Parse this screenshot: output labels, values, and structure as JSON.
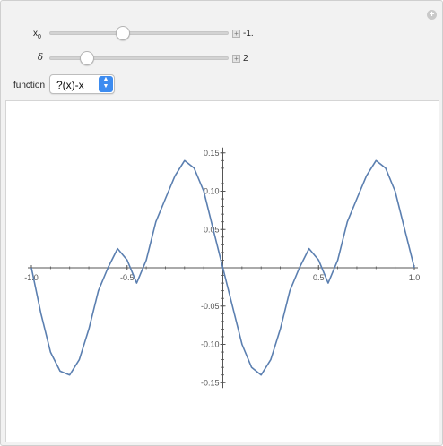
{
  "controls": {
    "x0": {
      "label": "x",
      "sub": "0",
      "value_text": "-1.",
      "value": -1.0
    },
    "delta": {
      "label": "δ",
      "value_text": "2",
      "value": 2
    },
    "function": {
      "label": "function",
      "selected": "?(x)-x"
    }
  },
  "icons": {
    "corner": "plus-circle-icon",
    "stepper": "plus-box-icon",
    "select_arrows": "up-down-chevron-icon"
  },
  "colors": {
    "curve": "#5b7fb0",
    "select_accent": "#3d8cf0",
    "axis": "#555555"
  },
  "chart_data": {
    "type": "line",
    "title": "",
    "xlabel": "",
    "ylabel": "",
    "xlim": [
      -1.0,
      1.0
    ],
    "ylim": [
      -0.15,
      0.15
    ],
    "x_ticks": [
      "-1.0",
      "-0.5",
      "0.5",
      "1.0"
    ],
    "y_ticks": [
      "0.15",
      "0.10",
      "0.05",
      "-0.05",
      "-0.10",
      "-0.15"
    ],
    "series": [
      {
        "x": [
          -1.0,
          -0.95,
          -0.9,
          -0.85,
          -0.8,
          -0.75,
          -0.7,
          -0.65,
          -0.6,
          -0.55,
          -0.5,
          -0.45,
          -0.4,
          -0.35,
          -0.3,
          -0.25,
          -0.2,
          -0.15,
          -0.1,
          -0.05,
          0.0,
          0.05,
          0.1,
          0.15,
          0.2,
          0.25,
          0.3,
          0.35,
          0.4,
          0.45,
          0.5,
          0.55,
          0.6,
          0.65,
          0.7,
          0.75,
          0.8,
          0.85,
          0.9,
          0.95,
          1.0
        ],
        "y": [
          0.0,
          -0.06,
          -0.11,
          -0.135,
          -0.14,
          -0.12,
          -0.08,
          -0.03,
          0.0,
          0.025,
          0.01,
          -0.02,
          0.01,
          0.06,
          0.09,
          0.12,
          0.14,
          0.13,
          0.1,
          0.05,
          0.0,
          -0.05,
          -0.1,
          -0.13,
          -0.14,
          -0.12,
          -0.08,
          -0.03,
          0.0,
          0.025,
          0.01,
          -0.02,
          0.01,
          0.06,
          0.09,
          0.12,
          0.14,
          0.13,
          0.1,
          0.05,
          0.0
        ]
      }
    ]
  }
}
